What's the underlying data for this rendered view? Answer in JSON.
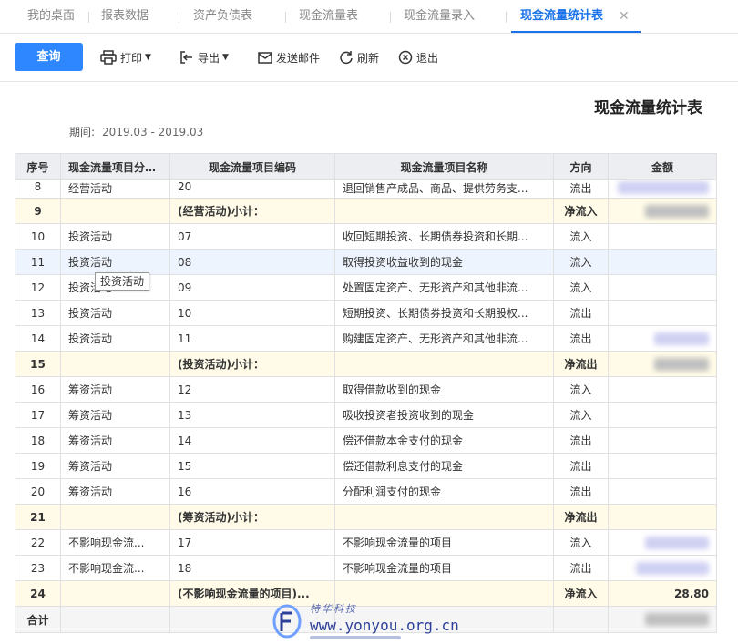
{
  "tabs": [
    {
      "label": "我的桌面"
    },
    {
      "label": "报表数据"
    },
    {
      "label": "资产负债表"
    },
    {
      "label": "现金流量表"
    },
    {
      "label": "现金流量录入"
    },
    {
      "label": "现金流量统计表",
      "active": true
    }
  ],
  "toolbar": {
    "query_label": "查询",
    "print_label": "打印",
    "export_label": "导出",
    "email_label": "发送邮件",
    "refresh_label": "刷新",
    "exit_label": "退出"
  },
  "report": {
    "title": "现金流量统计表",
    "period_label": "期间:",
    "period_value": "2019.03 - 2019.03"
  },
  "table": {
    "columns": [
      "序号",
      "现金流量项目分类名",
      "现金流量项目编码",
      "现金流量项目名称",
      "方向",
      "金额"
    ],
    "rows": [
      {
        "no": "8",
        "category": "经营活动",
        "code": "20",
        "name": "退回销售产成品、商品、提供劳务支...",
        "direction": "流出",
        "amount": "",
        "type": "first"
      },
      {
        "no": "9",
        "category": "",
        "code": "(经营活动)小计：",
        "name": "",
        "direction": "净流入",
        "amount": "",
        "type": "sub"
      },
      {
        "no": "10",
        "category": "投资活动",
        "code": "07",
        "name": "收回短期投资、长期债券投资和长期...",
        "direction": "流入",
        "amount": "",
        "type": "normal"
      },
      {
        "no": "11",
        "category": "投资活动",
        "code": "08",
        "name": "取得投资收益收到的现金",
        "direction": "流入",
        "amount": "",
        "type": "hl"
      },
      {
        "no": "12",
        "category": "投资活动",
        "code": "09",
        "name": "处置固定资产、无形资产和其他非流...",
        "direction": "流入",
        "amount": "",
        "type": "normal"
      },
      {
        "no": "13",
        "category": "投资活动",
        "code": "10",
        "name": "短期投资、长期债券投资和长期股权...",
        "direction": "流出",
        "amount": "",
        "type": "normal"
      },
      {
        "no": "14",
        "category": "投资活动",
        "code": "11",
        "name": "购建固定资产、无形资产和其他非流...",
        "direction": "流出",
        "amount": "",
        "type": "normal"
      },
      {
        "no": "15",
        "category": "",
        "code": "(投资活动)小计：",
        "name": "",
        "direction": "净流出",
        "amount": "",
        "type": "sub"
      },
      {
        "no": "16",
        "category": "筹资活动",
        "code": "12",
        "name": "取得借款收到的现金",
        "direction": "流入",
        "amount": "",
        "type": "normal"
      },
      {
        "no": "17",
        "category": "筹资活动",
        "code": "13",
        "name": "吸收投资者投资收到的现金",
        "direction": "流入",
        "amount": "",
        "type": "normal"
      },
      {
        "no": "18",
        "category": "筹资活动",
        "code": "14",
        "name": "偿还借款本金支付的现金",
        "direction": "流出",
        "amount": "",
        "type": "normal"
      },
      {
        "no": "19",
        "category": "筹资活动",
        "code": "15",
        "name": "偿还借款利息支付的现金",
        "direction": "流出",
        "amount": "",
        "type": "normal"
      },
      {
        "no": "20",
        "category": "筹资活动",
        "code": "16",
        "name": "分配利润支付的现金",
        "direction": "流出",
        "amount": "",
        "type": "normal"
      },
      {
        "no": "21",
        "category": "",
        "code": "(筹资活动)小计：",
        "name": "",
        "direction": "净流出",
        "amount": "",
        "type": "sub"
      },
      {
        "no": "22",
        "category": "不影响现金流...",
        "code": "17",
        "name": "不影响现金流量的项目",
        "direction": "流入",
        "amount": "",
        "type": "normal"
      },
      {
        "no": "23",
        "category": "不影响现金流...",
        "code": "18",
        "name": "不影响现金流量的项目",
        "direction": "流出",
        "amount": "",
        "type": "normal"
      },
      {
        "no": "24",
        "category": "",
        "code": "(不影响现金流量的项目)...",
        "name": "",
        "direction": "净流入",
        "amount": "28.80",
        "type": "sub"
      }
    ],
    "total_label": "合计"
  },
  "tooltip": {
    "text": "投资活动"
  },
  "watermark": {
    "top": "特华科技",
    "domain": "www.yonyou.org.cn"
  },
  "colors": {
    "accent": "#2e87ff",
    "tab_active": "#1a73e8",
    "subtotal_bg": "#fffbe8",
    "header_bg": "#eceef1",
    "blur_purple": "#cfd0f2",
    "blur_gray": "#bfbfbf"
  }
}
